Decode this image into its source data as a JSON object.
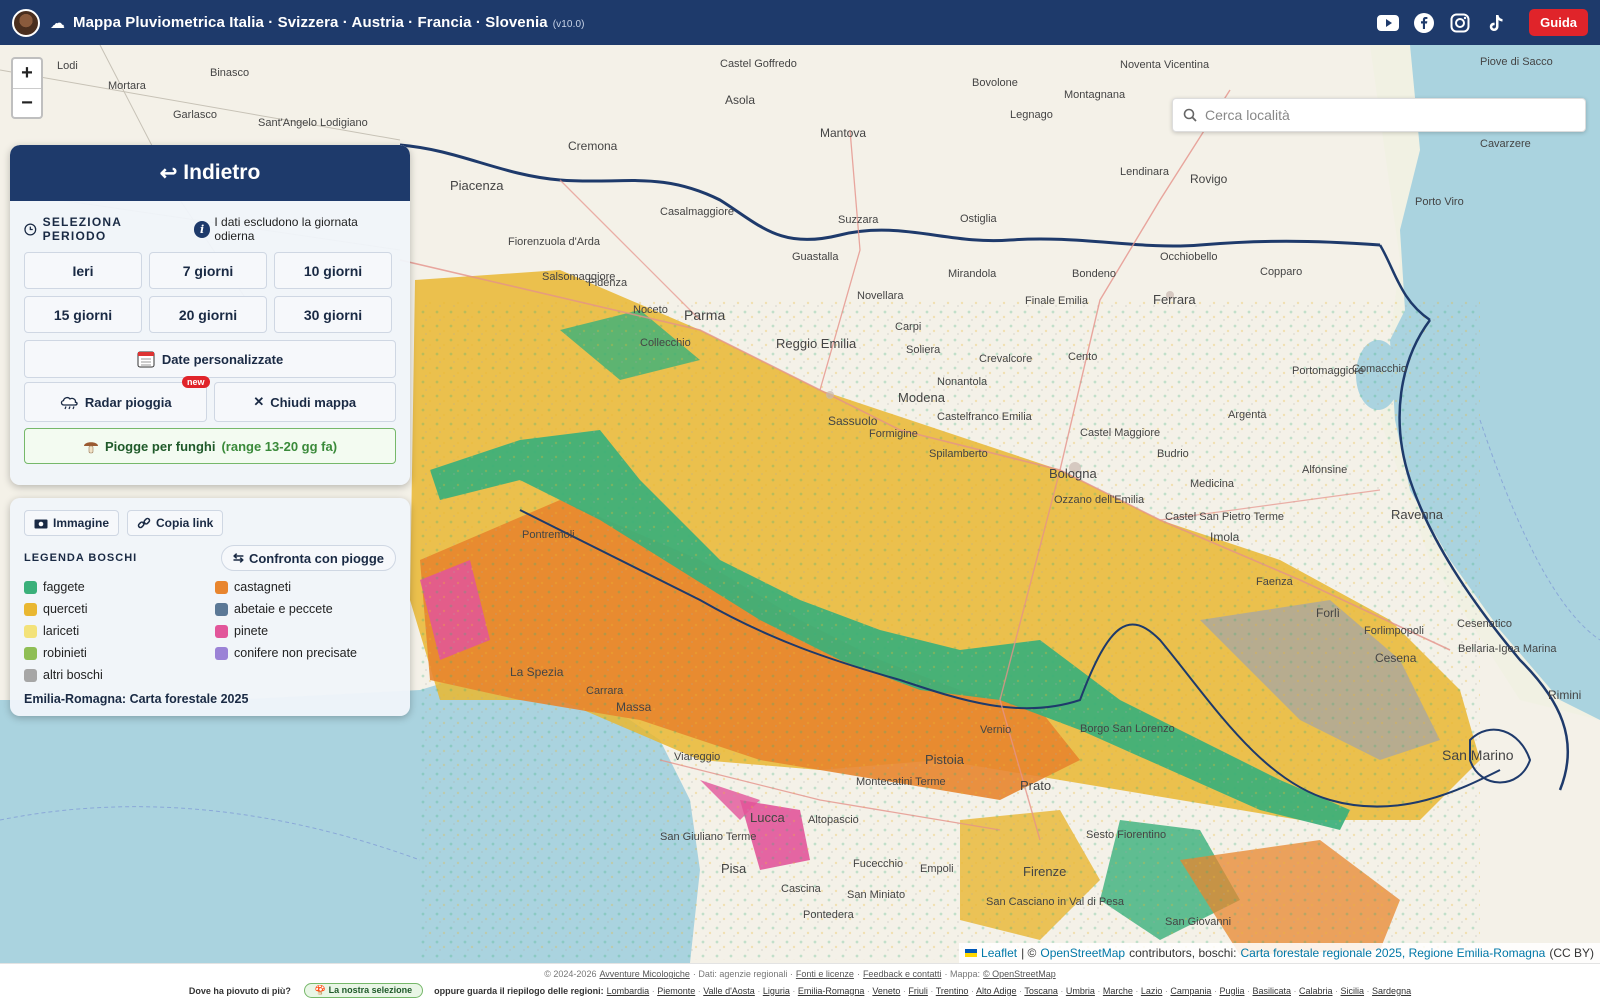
{
  "header": {
    "title": "Mappa Pluviometrica Italia · Svizzera · Austria · Francia · Slovenia",
    "version": "(v10.0)",
    "guide_label": "Guida",
    "social": [
      "youtube-icon",
      "facebook-icon",
      "instagram-icon",
      "tiktok-icon"
    ]
  },
  "map": {
    "zoom_in": "+",
    "zoom_out": "−",
    "search_placeholder": "Cerca località",
    "places": [
      {
        "name": "Castel Goffredo"
      },
      {
        "name": "Bovolone"
      },
      {
        "name": "Noventa Vicentina"
      },
      {
        "name": "Piove di Sacco"
      },
      {
        "name": "Mortara"
      },
      {
        "name": "Binasco"
      },
      {
        "name": "Montagnana"
      },
      {
        "name": "Asola"
      },
      {
        "name": "Rovigo"
      },
      {
        "name": "Mantova"
      },
      {
        "name": "Legnago"
      },
      {
        "name": "Cavarzere"
      },
      {
        "name": "Cremona"
      },
      {
        "name": "Lendinara"
      },
      {
        "name": "Piacenza"
      },
      {
        "name": "Casalmaggiore"
      },
      {
        "name": "Porto Viro"
      },
      {
        "name": "Suzzara"
      },
      {
        "name": "Ostiglia"
      },
      {
        "name": "Fiorenzuola d'Arda"
      },
      {
        "name": "Guastalla"
      },
      {
        "name": "Occhiobello"
      },
      {
        "name": "Copparo"
      },
      {
        "name": "Fidenza"
      },
      {
        "name": "Mirandola"
      },
      {
        "name": "Bondeno"
      },
      {
        "name": "Ferrara"
      },
      {
        "name": "Parma"
      },
      {
        "name": "Novellara"
      },
      {
        "name": "Finale Emilia"
      },
      {
        "name": "Carpi"
      },
      {
        "name": "Reggio Emilia"
      },
      {
        "name": "Soliera"
      },
      {
        "name": "Crevalcore"
      },
      {
        "name": "Cento"
      },
      {
        "name": "Portomaggiore"
      },
      {
        "name": "Comacchio"
      },
      {
        "name": "Modena"
      },
      {
        "name": "Nonantola"
      },
      {
        "name": "Argenta"
      },
      {
        "name": "Castelfranco Emilia"
      },
      {
        "name": "Castel Maggiore"
      },
      {
        "name": "Sassuolo"
      },
      {
        "name": "Formigine"
      },
      {
        "name": "Spilamberto"
      },
      {
        "name": "Budrio"
      },
      {
        "name": "Bologna"
      },
      {
        "name": "Alfonsine"
      },
      {
        "name": "Medicina"
      },
      {
        "name": "Ravenna"
      },
      {
        "name": "Castel San Pietro Terme"
      },
      {
        "name": "Ozzano dell'Emilia"
      },
      {
        "name": "Imola"
      },
      {
        "name": "Faenza"
      },
      {
        "name": "Forlì"
      },
      {
        "name": "Cesenatico"
      },
      {
        "name": "Forlimpopoli"
      },
      {
        "name": "Cesena"
      },
      {
        "name": "Bellaria-Igea Marina"
      },
      {
        "name": "Rimini"
      },
      {
        "name": "San Marino"
      },
      {
        "name": "La Spezia"
      },
      {
        "name": "Massa"
      },
      {
        "name": "Pistoia"
      },
      {
        "name": "Prato"
      },
      {
        "name": "Lucca"
      },
      {
        "name": "Firenze"
      },
      {
        "name": "Pisa"
      },
      {
        "name": "Empoli"
      },
      {
        "name": "Cascina"
      },
      {
        "name": "Borgo San Lorenzo"
      },
      {
        "name": "Vernio"
      },
      {
        "name": "Sesto Fiorentino"
      },
      {
        "name": "Pontremoli"
      },
      {
        "name": "Montecatini Terme"
      },
      {
        "name": "Altopascio"
      },
      {
        "name": "San Casciano in Val di Pesa"
      },
      {
        "name": "San Giovanni"
      },
      {
        "name": "San Miniato"
      },
      {
        "name": "Fucecchio"
      },
      {
        "name": "Collecchio"
      },
      {
        "name": "Noceto"
      },
      {
        "name": "Salsomaggiore"
      },
      {
        "name": "Lodi"
      },
      {
        "name": "Garlasco"
      },
      {
        "name": "Sant'Angelo Lodigiano"
      },
      {
        "name": "San Giuliano Terme"
      },
      {
        "name": "Pontedera"
      },
      {
        "name": "Viareggio"
      },
      {
        "name": "Carrara"
      }
    ]
  },
  "panel": {
    "back_label": "Indietro",
    "period_title": "SELEZIONA PERIODO",
    "period_note": "I dati escludono la giornata odierna",
    "periods": [
      "Ieri",
      "7 giorni",
      "10 giorni",
      "15 giorni",
      "20 giorni",
      "30 giorni"
    ],
    "custom_dates": "Date personalizzate",
    "radar": "Radar pioggia",
    "new_badge": "new",
    "close_map": "Chiudi mappa",
    "funghi_label": "Piogge per funghi",
    "funghi_range": "(range 13-20 gg fa)"
  },
  "legend": {
    "image_btn": "Immagine",
    "copy_btn": "Copia link",
    "title": "LEGENDA BOSCHI",
    "compare_btn": "Confronta con piogge",
    "items": [
      {
        "label": "faggete",
        "color": "#3ab07a"
      },
      {
        "label": "castagneti",
        "color": "#e8852e"
      },
      {
        "label": "querceti",
        "color": "#e9b731"
      },
      {
        "label": "abetaie e peccete",
        "color": "#5b7896"
      },
      {
        "label": "lariceti",
        "color": "#f3e27a"
      },
      {
        "label": "pinete",
        "color": "#e2559a"
      },
      {
        "label": "robinieti",
        "color": "#8fbe55"
      },
      {
        "label": "conifere non precisate",
        "color": "#9b82d6"
      },
      {
        "label": "altri boschi",
        "color": "#a6a6a6"
      }
    ],
    "source": "Emilia-Romagna: Carta forestale 2025"
  },
  "attribution": {
    "leaflet": "Leaflet",
    "sep": "| ©",
    "osm": "OpenStreetMap",
    "contrib": "contributors, boschi:",
    "carta": "Carta forestale regionale 2025, Regione Emilia-Romagna",
    "license": "(CC BY)"
  },
  "footer": {
    "copyright": "© 2024-2026",
    "site": "Avventure Micologiche",
    "data_src": "· Dati: agenzie regionali ·",
    "fonti": "Fonti e licenze",
    "dot1": "·",
    "feedback": "Feedback e contatti",
    "map_src": "· Mappa:",
    "osm": "© OpenStreetMap",
    "question": "Dove ha piovuto di più?",
    "selection": "La nostra selezione",
    "or_text": "oppure guarda il riepilogo delle regioni:",
    "regions": [
      "Lombardia",
      "Piemonte",
      "Valle d'Aosta",
      "Liguria",
      "Emilia-Romagna",
      "Veneto",
      "Friuli",
      "Trentino",
      "Alto Adige",
      "Toscana",
      "Umbria",
      "Marche",
      "Lazio",
      "Campania",
      "Puglia",
      "Basilicata",
      "Calabria",
      "Sicilia",
      "Sardegna"
    ]
  }
}
